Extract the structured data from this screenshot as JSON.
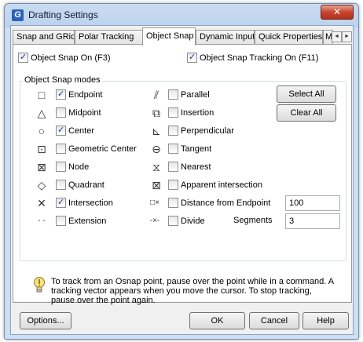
{
  "window": {
    "title": "Drafting Settings",
    "close_label": "✕"
  },
  "tabs": [
    {
      "label": "Snap and GRid"
    },
    {
      "label": "Polar Tracking"
    },
    {
      "label": "Object Snap"
    },
    {
      "label": "Dynamic Input"
    },
    {
      "label": "Quick Properties"
    },
    {
      "label": "Mo"
    }
  ],
  "tab_scroll": {
    "left": "◄",
    "right": "►"
  },
  "top_checks": {
    "osnap_on": {
      "label": "Object Snap On (F3)",
      "checked": true
    },
    "tracking_on": {
      "label": "Object Snap Tracking On (F11)",
      "checked": true
    }
  },
  "group_title": "Object Snap modes",
  "left_modes": [
    {
      "label": "Endpoint",
      "checked": true,
      "icon": "endpoint-icon",
      "glyph": "□"
    },
    {
      "label": "Midpoint",
      "checked": false,
      "icon": "midpoint-icon",
      "glyph": "△"
    },
    {
      "label": "Center",
      "checked": true,
      "icon": "center-icon",
      "glyph": "○"
    },
    {
      "label": "Geometric Center",
      "checked": false,
      "icon": "geometric-center-icon",
      "glyph": "⊡"
    },
    {
      "label": "Node",
      "checked": false,
      "icon": "node-icon",
      "glyph": "⊠"
    },
    {
      "label": "Quadrant",
      "checked": false,
      "icon": "quadrant-icon",
      "glyph": "◇"
    },
    {
      "label": "Intersection",
      "checked": true,
      "icon": "intersection-icon",
      "glyph": "✕"
    },
    {
      "label": "Extension",
      "checked": false,
      "icon": "extension-icon",
      "glyph": "- -"
    }
  ],
  "right_modes": [
    {
      "label": "Parallel",
      "checked": false,
      "icon": "parallel-icon",
      "glyph": "⫽"
    },
    {
      "label": "Insertion",
      "checked": false,
      "icon": "insertion-icon",
      "glyph": "⧉"
    },
    {
      "label": "Perpendicular",
      "checked": false,
      "icon": "perpendicular-icon",
      "glyph": "⊾"
    },
    {
      "label": "Tangent",
      "checked": false,
      "icon": "tangent-icon",
      "glyph": "⊖"
    },
    {
      "label": "Nearest",
      "checked": false,
      "icon": "nearest-icon",
      "glyph": "⧖"
    },
    {
      "label": "Apparent intersection",
      "checked": false,
      "icon": "apparent-intersection-icon",
      "glyph": "⊠"
    },
    {
      "label": "Distance from Endpoint",
      "checked": false,
      "icon": "distance-from-endpoint-icon",
      "glyph": "□×"
    },
    {
      "label": "Divide",
      "checked": false,
      "icon": "divide-icon",
      "glyph": "-×-"
    }
  ],
  "buttons": {
    "select_all": "Select All",
    "clear_all": "Clear All"
  },
  "distance_value": "100",
  "segments": {
    "label": "Segments",
    "value": "3"
  },
  "tip": "To track from an Osnap point, pause over the point while in a command.  A tracking vector appears when you move the cursor.  To stop tracking, pause over the point again.",
  "footer": {
    "options": "Options...",
    "ok": "OK",
    "cancel": "Cancel",
    "help": "Help"
  }
}
